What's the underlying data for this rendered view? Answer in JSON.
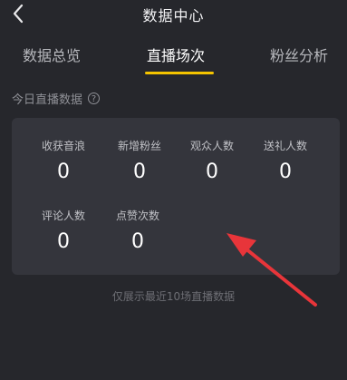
{
  "header": {
    "title": "数据中心"
  },
  "tabs": [
    {
      "label": "数据总览"
    },
    {
      "label": "直播场次"
    },
    {
      "label": "粉丝分析"
    }
  ],
  "section": {
    "title": "今日直播数据"
  },
  "stats": [
    {
      "label": "收获音浪",
      "value": "0"
    },
    {
      "label": "新增粉丝",
      "value": "0"
    },
    {
      "label": "观众人数",
      "value": "0"
    },
    {
      "label": "送礼人数",
      "value": "0"
    },
    {
      "label": "评论人数",
      "value": "0"
    },
    {
      "label": "点赞次数",
      "value": "0"
    }
  ],
  "footnote": "仅展示最近10场直播数据",
  "colors": {
    "background": "#26272c",
    "card": "#34353c",
    "accent": "#f5c400",
    "annotation_arrow": "#e8353a"
  }
}
